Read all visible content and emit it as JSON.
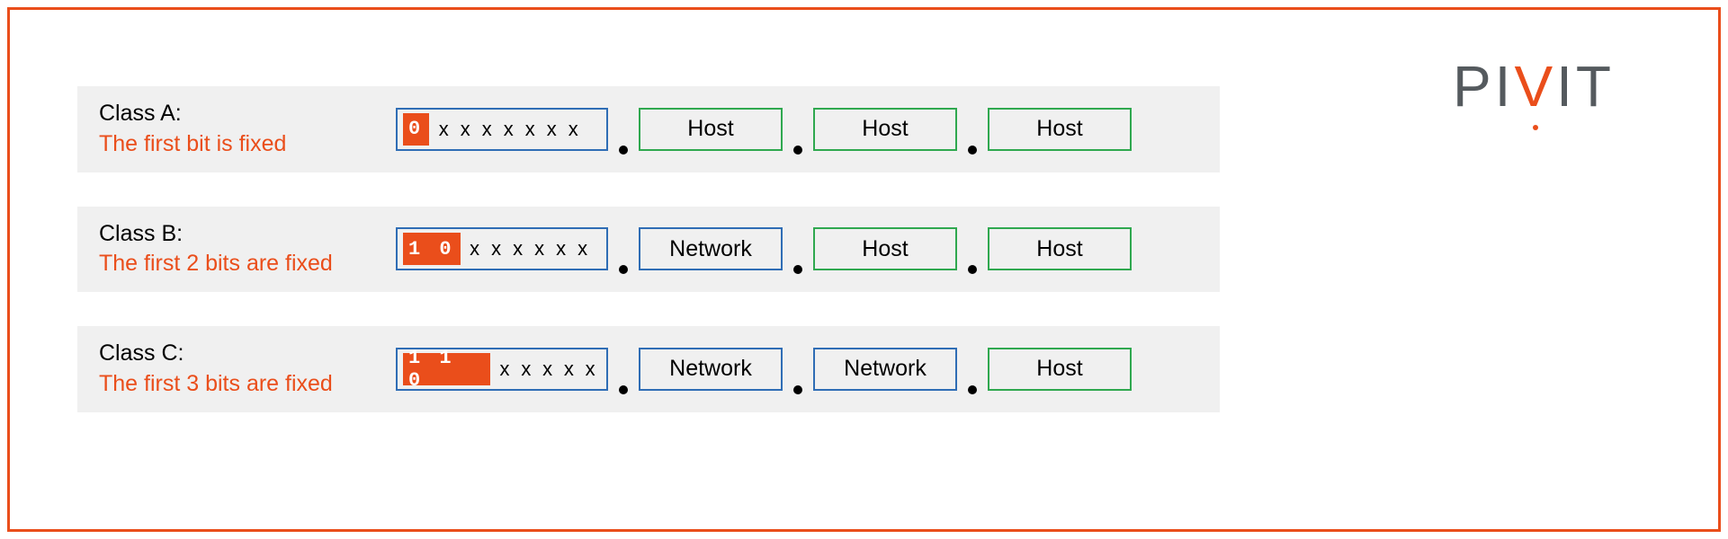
{
  "logo": {
    "p1": "PI",
    "v": "V",
    "p2": "IT"
  },
  "classes": [
    {
      "title": "Class A:",
      "subtitle": "The first bit is fixed",
      "fixed_bits": "0",
      "free_bits": [
        "x",
        "x",
        "x",
        "x",
        "x",
        "x",
        "x"
      ],
      "octets": [
        {
          "label": "Host",
          "kind": "host"
        },
        {
          "label": "Host",
          "kind": "host"
        },
        {
          "label": "Host",
          "kind": "host"
        }
      ]
    },
    {
      "title": "Class B:",
      "subtitle": "The first 2 bits are fixed",
      "fixed_bits": "1 0",
      "free_bits": [
        "x",
        "x",
        "x",
        "x",
        "x",
        "x"
      ],
      "octets": [
        {
          "label": "Network",
          "kind": "net"
        },
        {
          "label": "Host",
          "kind": "host"
        },
        {
          "label": "Host",
          "kind": "host"
        }
      ]
    },
    {
      "title": "Class C:",
      "subtitle": "The first 3 bits are fixed",
      "fixed_bits": "1 1 0",
      "free_bits": [
        "x",
        "x",
        "x",
        "x",
        "x"
      ],
      "octets": [
        {
          "label": "Network",
          "kind": "net"
        },
        {
          "label": "Network",
          "kind": "net"
        },
        {
          "label": "Host",
          "kind": "host"
        }
      ]
    }
  ],
  "colors": {
    "accent": "#ea4e1b",
    "net_border": "#2f6db5",
    "host_border": "#2fa84f",
    "row_bg": "#f0f0f0"
  }
}
